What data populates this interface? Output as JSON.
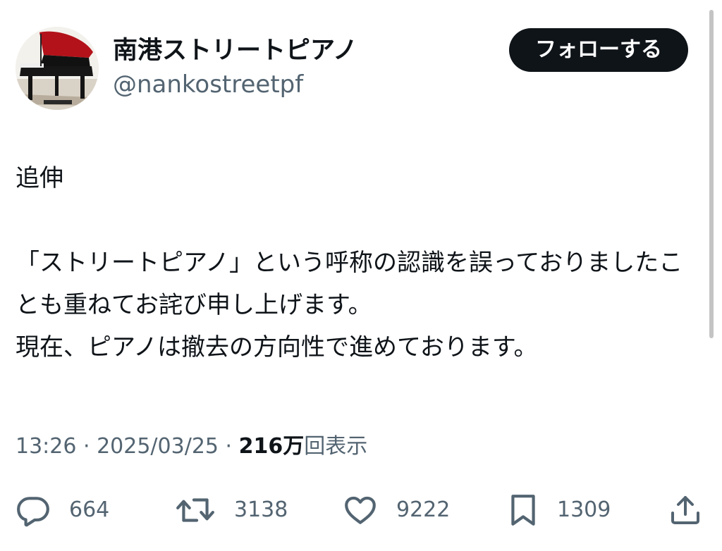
{
  "user": {
    "display_name": "南港ストリートピアノ",
    "handle": "@nankostreetpf",
    "avatar_icon": "grand-piano-avatar"
  },
  "follow_button": {
    "label": "フォローする"
  },
  "tweet": {
    "text": "追伸\n\n「ストリートピアノ」という呼称の認識を誤っておりましたことも重ねてお詫び申し上げます。\n現在、ピアノは撤去の方向性で進めております。"
  },
  "meta": {
    "time": "13:26",
    "separator": " · ",
    "date": "2025/03/25",
    "views_count": "216万",
    "views_label": "回表示"
  },
  "actions": {
    "reply": {
      "icon": "reply-icon",
      "count": "664"
    },
    "retweet": {
      "icon": "retweet-icon",
      "count": "3138"
    },
    "like": {
      "icon": "heart-icon",
      "count": "9222"
    },
    "bookmark": {
      "icon": "bookmark-icon",
      "count": "1309"
    },
    "share": {
      "icon": "share-icon"
    }
  },
  "colors": {
    "text": "#0f1419",
    "secondary": "#536471",
    "button_bg": "#0f1419",
    "button_text": "#ffffff",
    "background": "#ffffff"
  }
}
